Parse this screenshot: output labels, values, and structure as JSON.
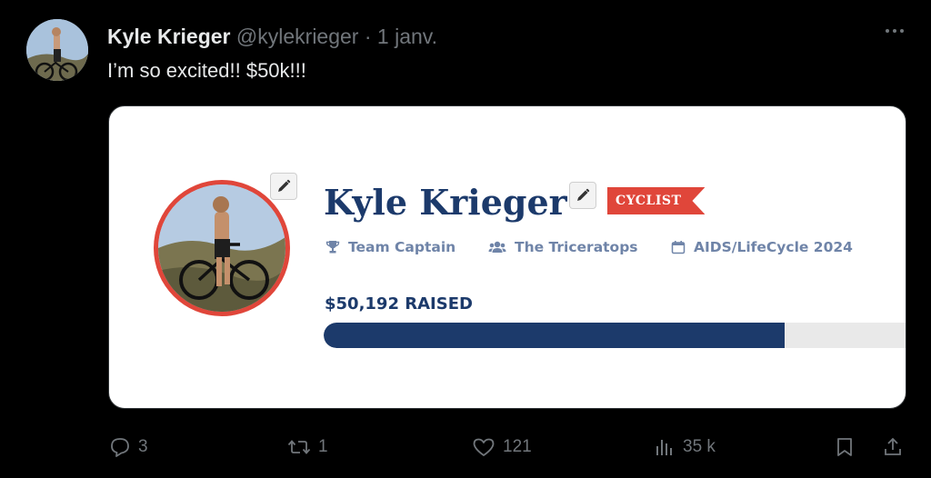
{
  "tweet": {
    "author_name": "Kyle Krieger",
    "author_handle": "@kylekrieger",
    "separator": "·",
    "date": "1 janv.",
    "text": "I’m so excited!! $50k!!!"
  },
  "card": {
    "name": "Kyle Krieger",
    "badge": "CYCLIST",
    "meta": [
      {
        "icon": "trophy-icon",
        "label": "Team Captain"
      },
      {
        "icon": "users-icon",
        "label": "The Triceratops"
      },
      {
        "icon": "calendar-icon",
        "label": "AIDS/LifeCycle 2024"
      }
    ],
    "raised": "$50,192 RAISED",
    "progress_fraction": 0.78,
    "colors": {
      "navy": "#1c3a6b",
      "red": "#e0463a"
    }
  },
  "actions": {
    "replies": "3",
    "reposts": "1",
    "likes": "121",
    "views": "35 k"
  }
}
